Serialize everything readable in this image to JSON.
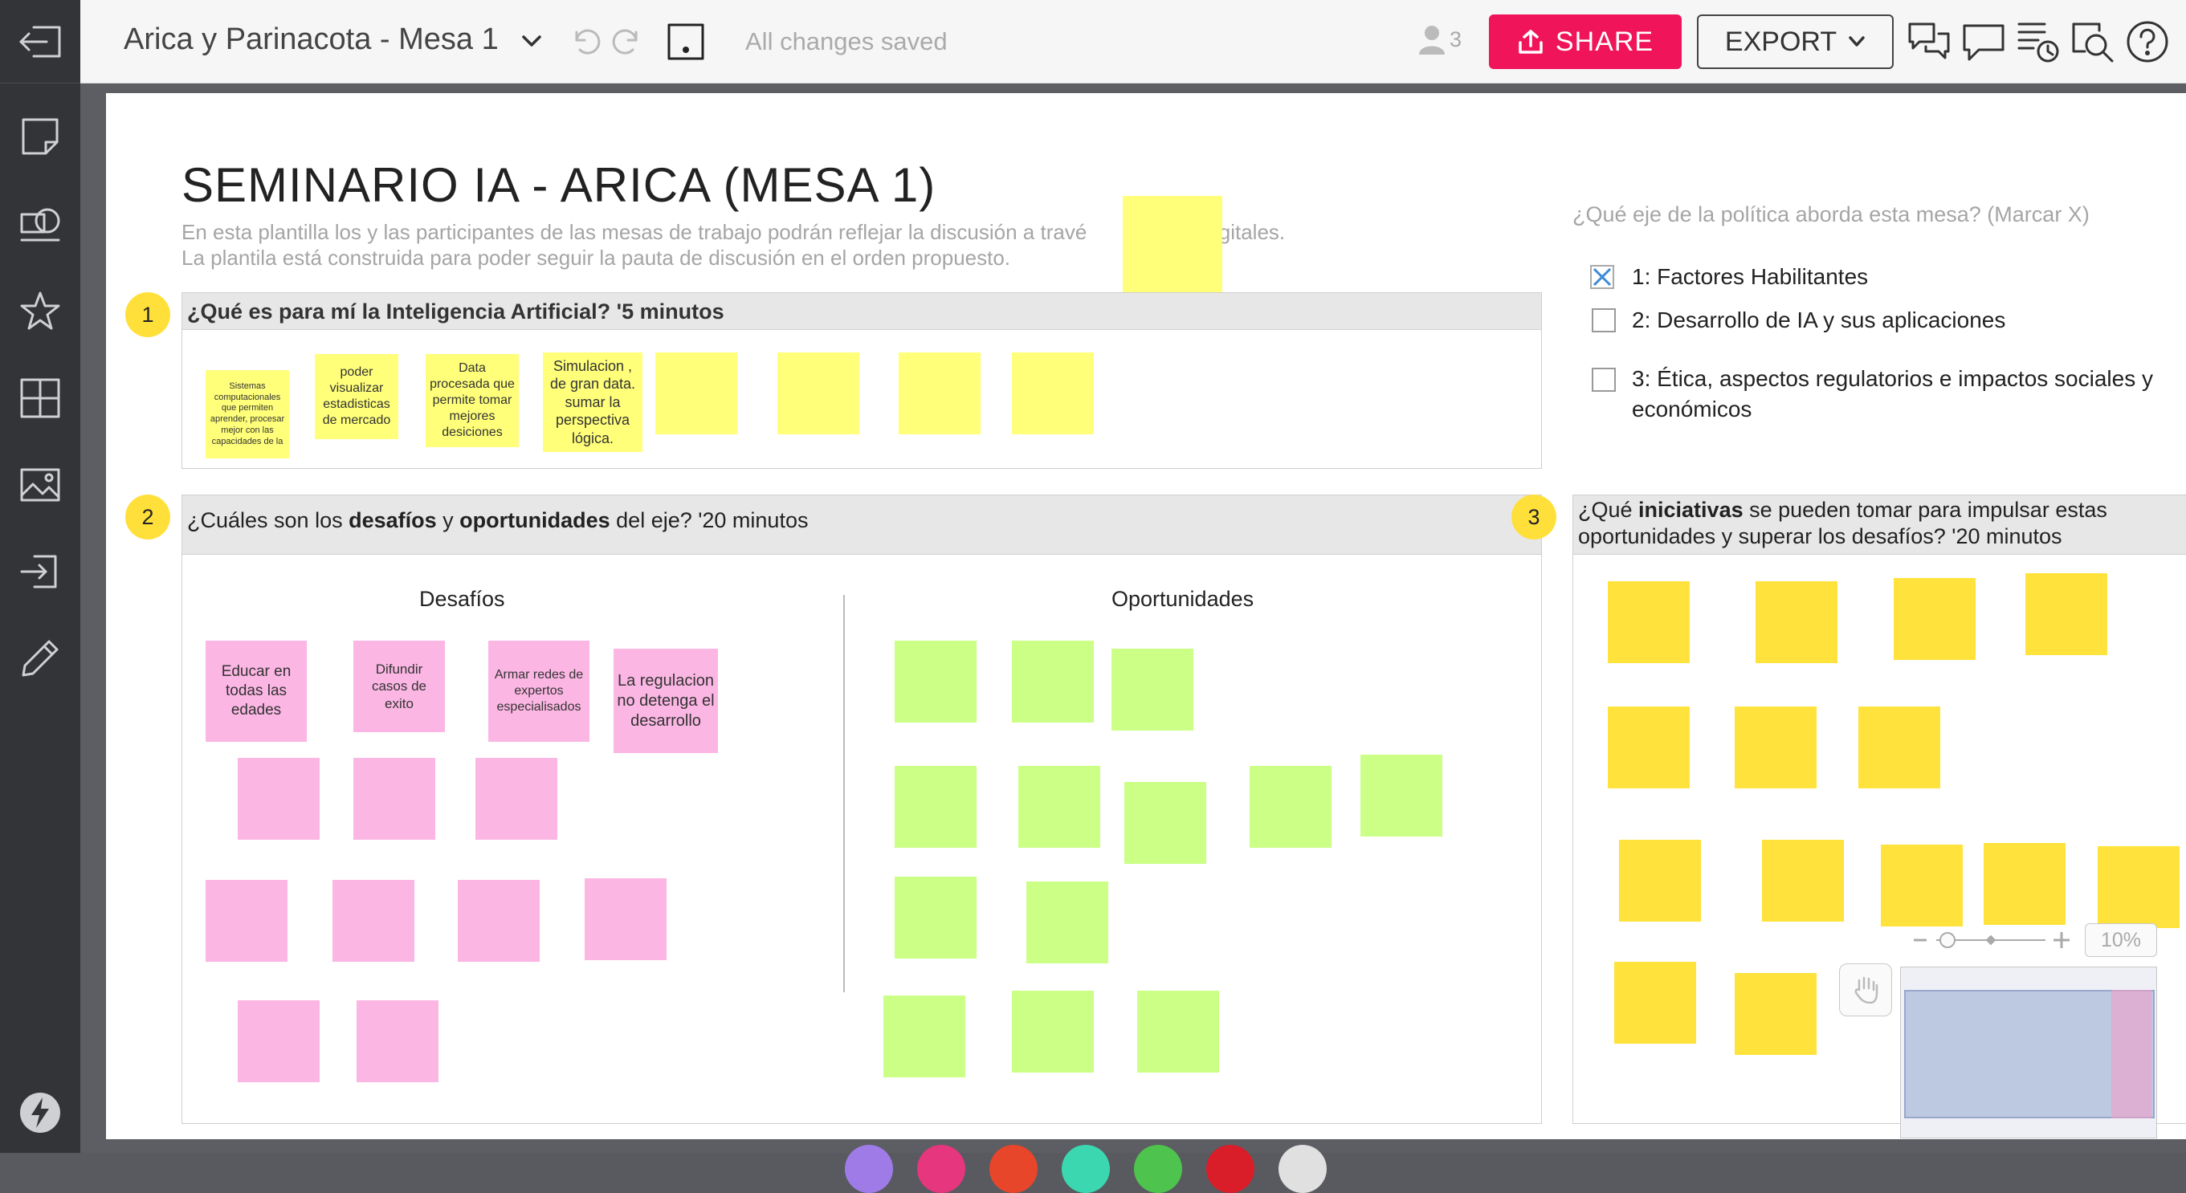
{
  "toolbar": {
    "title": "Arica y Parinacota - Mesa 1",
    "saved_status": "All changes saved",
    "user_count": "3",
    "share_label": "SHARE",
    "export_label": "EXPORT"
  },
  "board": {
    "title": "SEMINARIO IA - ARICA (MESA 1)",
    "desc_line1": "En esta plantilla los y las participantes de las mesas de trabajo podrán reflejar la discusión a travé",
    "desc_line1_end": "it digitales.",
    "desc_line2": "La plantila está construida para poder seguir la pauta de discusión en el orden propuesto."
  },
  "section1": {
    "number": "1",
    "title": "¿Qué es para mí la Inteligencia Artificial?  '5 minutos",
    "notes": [
      "Sistemas computacionales que permiten aprender, procesar  mejor con las capacidades de la",
      "poder visualizar estadisticas de mercado",
      "Data procesada que permite tomar mejores desiciones",
      "Simulacion , de gran data. sumar la perspectiva lógica.",
      "",
      "",
      "",
      ""
    ]
  },
  "section2": {
    "number": "2",
    "title_pre": "¿Cuáles son los ",
    "title_b1": "desafíos",
    "title_mid": " y ",
    "title_b2": "oportunidades",
    "title_post": " del eje?  '20 minutos",
    "col_left": "Desafíos",
    "col_right": "Oportunidades",
    "desafios": [
      "Educar en todas las edades",
      "Difundir casos de exito",
      "Armar redes de expertos especialisados",
      "La regulacion no detenga el desarrollo"
    ]
  },
  "section3": {
    "number": "3",
    "title_pre": "¿Qué ",
    "title_b": "iniciativas",
    "title_post_line1": " se pueden tomar para impulsar estas",
    "title_line2": "oportunidades y superar los desafíos?  '20 minutos"
  },
  "axes": {
    "question": "¿Qué eje de la política aborda esta mesa?  (Marcar X)",
    "items": [
      {
        "label": "1: Factores Habilitantes",
        "checked": true
      },
      {
        "label": "2: Desarrollo de IA y sus aplicaciones",
        "checked": false
      },
      {
        "label": "3: Ética, aspectos regulatorios e impactos sociales y",
        "label2": "económicos",
        "checked": false
      }
    ]
  },
  "zoom": {
    "percent": "10%",
    "level": 0.1
  },
  "colors": {
    "share": "#f0145a",
    "sticky_yellow": "#ffff7a",
    "sticky_pink": "#fbb6e3",
    "sticky_green": "#cbff85",
    "sticky_gold": "#ffe23b",
    "badge": "#ffe03a"
  },
  "icons": [
    "exit-icon",
    "sticky-note-icon",
    "shapes-icon",
    "star-icon",
    "grid-icon",
    "image-icon",
    "import-icon",
    "pen-icon",
    "lightning-icon",
    "undo-icon",
    "redo-icon",
    "background-dot-icon",
    "user-icon",
    "upload-icon",
    "chevron-down-icon",
    "comments-icon",
    "chat-icon",
    "history-icon",
    "search-icon",
    "help-icon",
    "hand-icon"
  ]
}
